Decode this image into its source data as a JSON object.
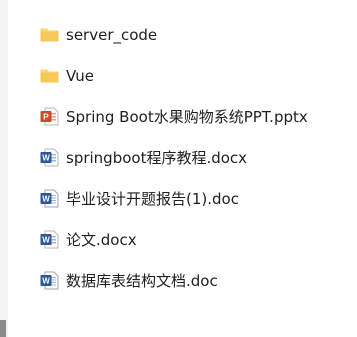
{
  "files": [
    {
      "name": "server_code",
      "icon": "folder-icon"
    },
    {
      "name": "Vue",
      "icon": "folder-icon"
    },
    {
      "name": "Spring Boot水果购物系统PPT.pptx",
      "icon": "powerpoint-icon"
    },
    {
      "name": "springboot程序教程.docx",
      "icon": "word-icon"
    },
    {
      "name": "毕业设计开题报告(1).doc",
      "icon": "word-doc-icon"
    },
    {
      "name": "论文.docx",
      "icon": "word-icon"
    },
    {
      "name": "数据库表结构文档.doc",
      "icon": "word-doc-icon"
    }
  ],
  "colors": {
    "folder": "#f6c85a",
    "powerpoint": "#d24726",
    "word": "#2b579a"
  }
}
